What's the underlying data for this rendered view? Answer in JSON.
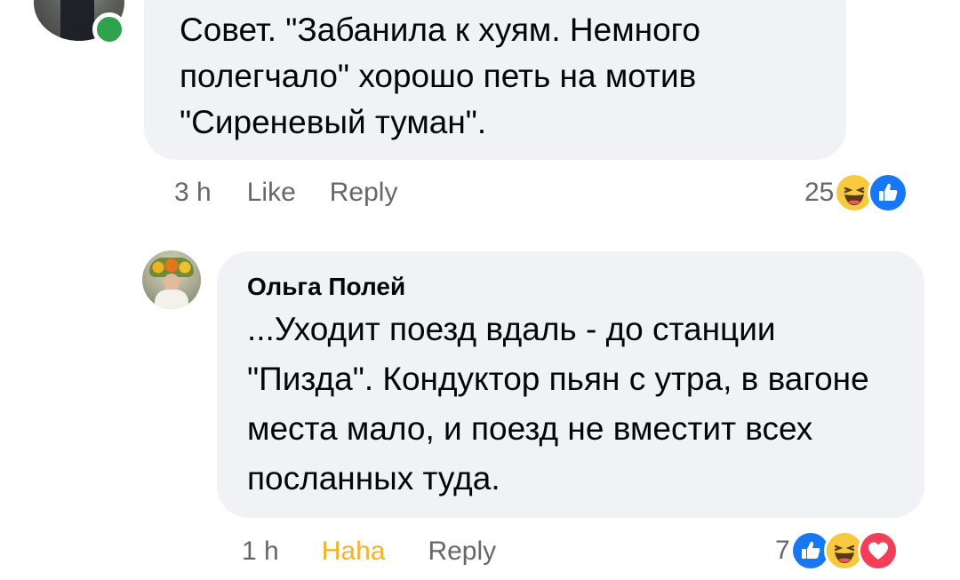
{
  "comments": [
    {
      "text": "Совет. \"Забанила к хуям. Немного полегчало\" хорошо петь на мотив \"Сиреневый туман\".",
      "time": "3 h",
      "like_label": "Like",
      "reply_label": "Reply",
      "reaction_count": "25",
      "reactions": [
        "haha-icon",
        "like-icon"
      ],
      "online": true
    },
    {
      "author": "Ольга Полей",
      "text": "...Уходит поезд вдаль - до станции \"Пизда\". Кондуктор пьян с утра, в вагоне места мало, и поезд не вместит всех посланных туда.",
      "time": "1 h",
      "like_label": "Haha",
      "reply_label": "Reply",
      "reaction_count": "7",
      "reactions": [
        "like-icon",
        "haha-icon",
        "love-icon"
      ]
    }
  ],
  "colors": {
    "bubble": "#f0f2f5",
    "meta_text": "#65676b",
    "haha_active": "#f7b125",
    "online": "#31a24c",
    "like_blue": "#1877f2",
    "love_red": "#f33e58"
  }
}
